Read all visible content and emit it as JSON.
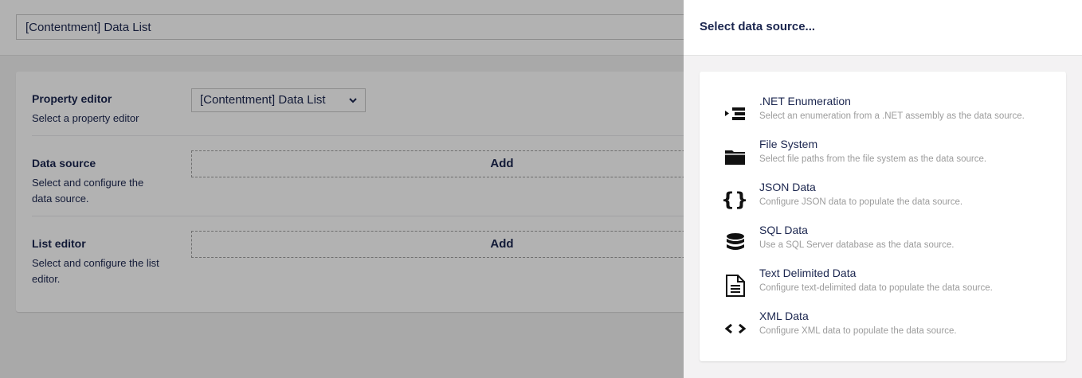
{
  "editor": {
    "name_value": "[Contentment] Data List",
    "rows": [
      {
        "title": "Property editor",
        "description": "Select a property editor",
        "select_value": "[Contentment] Data List"
      },
      {
        "title": "Data source",
        "description": "Select and configure the data source.",
        "button": "Add"
      },
      {
        "title": "List editor",
        "description": "Select and configure the list editor.",
        "button": "Add"
      }
    ]
  },
  "panel": {
    "title": "Select data source...",
    "items": [
      {
        "name": ".NET Enumeration",
        "description": "Select an enumeration from a .NET assembly as the data source.",
        "icon": "list-icon"
      },
      {
        "name": "File System",
        "description": "Select file paths from the file system as the data source.",
        "icon": "folder-icon"
      },
      {
        "name": "JSON Data",
        "description": "Configure JSON data to populate the data source.",
        "icon": "braces-icon"
      },
      {
        "name": "SQL Data",
        "description": "Use a SQL Server database as the data source.",
        "icon": "database-icon"
      },
      {
        "name": "Text Delimited Data",
        "description": "Configure text-delimited data to populate the data source.",
        "icon": "document-icon"
      },
      {
        "name": "XML Data",
        "description": "Configure XML data to populate the data source.",
        "icon": "code-icon"
      }
    ]
  },
  "colors": {
    "text": "#1b264f",
    "muted": "#9c9c9c",
    "panel_bg": "#f3f2f3"
  }
}
